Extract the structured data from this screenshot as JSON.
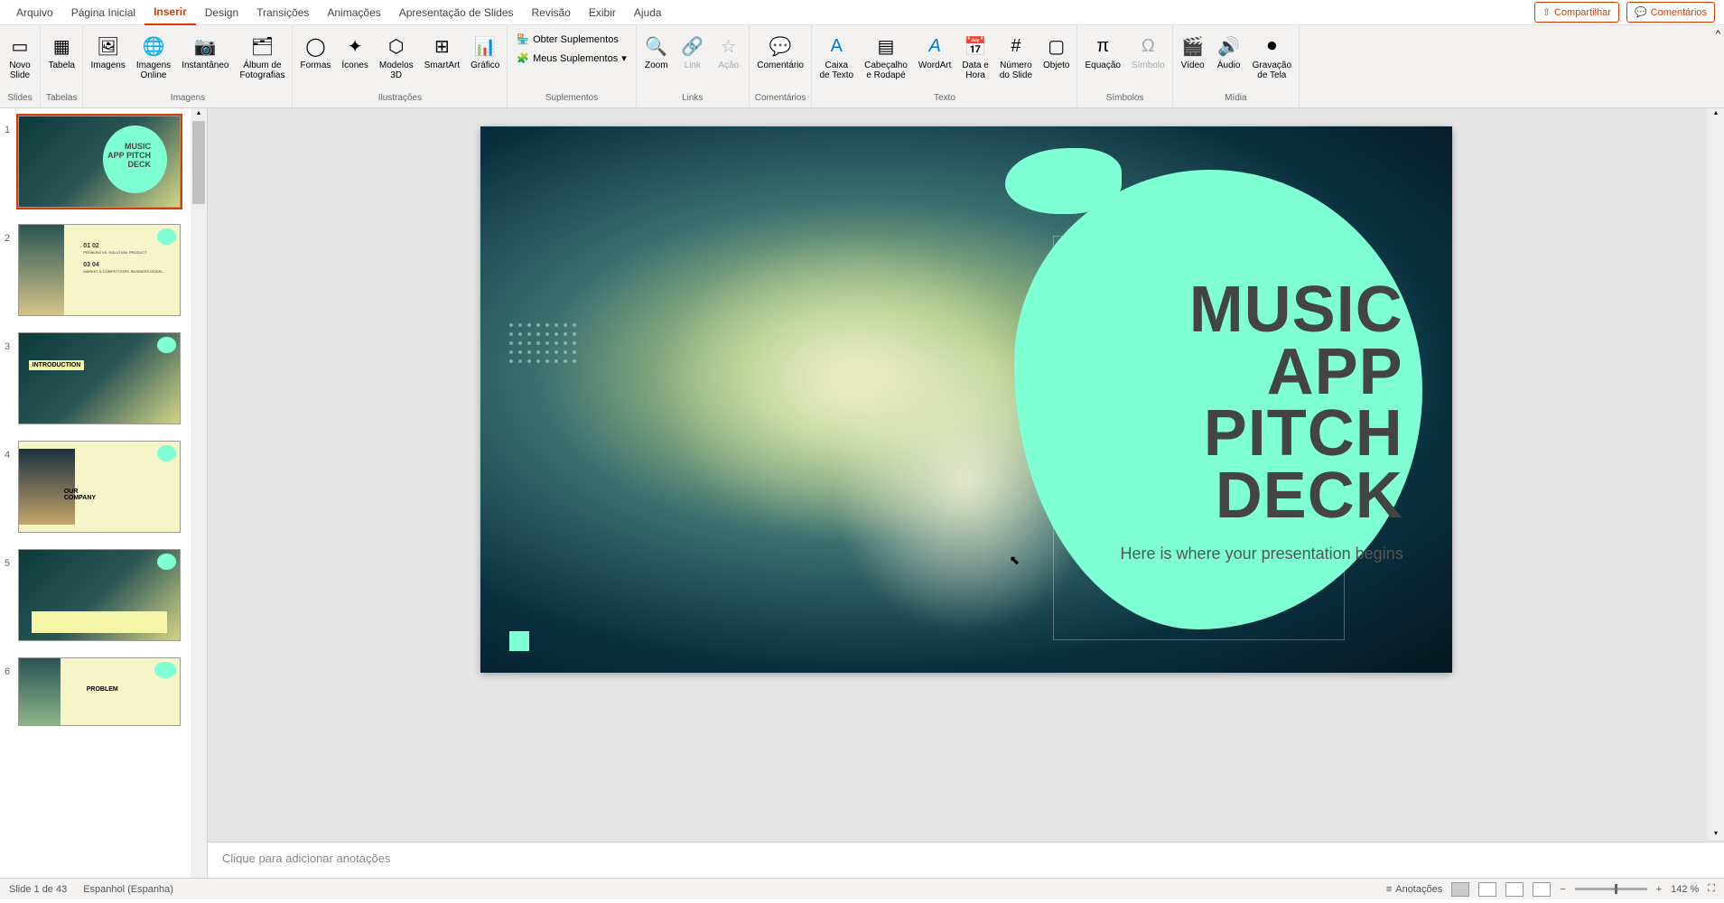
{
  "tabs": {
    "arquivo": "Arquivo",
    "pagina_inicial": "Página Inicial",
    "inserir": "Inserir",
    "design": "Design",
    "transicoes": "Transições",
    "animacoes": "Animações",
    "apresentacao": "Apresentação de Slides",
    "revisao": "Revisão",
    "exibir": "Exibir",
    "ajuda": "Ajuda"
  },
  "top_right": {
    "compartilhar": "Compartilhar",
    "comentarios": "Comentários"
  },
  "ribbon": {
    "novo_slide": "Novo\nSlide",
    "tabela": "Tabela",
    "imagens": "Imagens",
    "imagens_online": "Imagens\nOnline",
    "instantaneo": "Instantâneo",
    "album_fotografias": "Álbum de\nFotografias",
    "formas": "Formas",
    "icones": "Ícones",
    "modelos_3d": "Modelos\n3D",
    "smartart": "SmartArt",
    "grafico": "Gráfico",
    "obter_suplementos": "Obter Suplementos",
    "meus_suplementos": "Meus Suplementos",
    "zoom": "Zoom",
    "link": "Link",
    "acao": "Ação",
    "comentario": "Comentário",
    "caixa_texto": "Caixa\nde Texto",
    "cabecalho_rodape": "Cabeçalho\ne Rodapé",
    "wordart": "WordArt",
    "data_hora": "Data e\nHora",
    "numero_slide": "Número\ndo Slide",
    "objeto": "Objeto",
    "equacao": "Equação",
    "simbolo": "Símbolo",
    "video": "Vídeo",
    "audio": "Áudio",
    "gravacao_tela": "Gravação\nde Tela",
    "groups": {
      "slides": "Slides",
      "tabelas": "Tabelas",
      "imagens_g": "Imagens",
      "ilustracoes": "Ilustrações",
      "suplementos": "Suplementos",
      "links": "Links",
      "comentarios_g": "Comentários",
      "texto": "Texto",
      "simbolos": "Símbolos",
      "midia": "Mídia"
    }
  },
  "slide": {
    "title_line1": "MUSIC",
    "title_line2": "APP PITCH",
    "title_line3": "DECK",
    "subtitle": "Here is where your presentation begins"
  },
  "thumbnails": {
    "s2_01": "01",
    "s2_02": "02",
    "s2_03": "03",
    "s2_04": "04",
    "s2_t1": "PROBLEM VS. SOLUTION",
    "s2_t2": "PRODUCT",
    "s2_t3": "MARKET & COMPETITORS",
    "s2_t4": "BUSINESS MODEL",
    "s3_title": "INTRODUCTION",
    "s4_title": "OUR\nCOMPANY",
    "s6_title": "PROBLEM"
  },
  "notes": {
    "placeholder": "Clique para adicionar anotações"
  },
  "status": {
    "slide_count": "Slide 1 de 43",
    "language": "Espanhol (Espanha)",
    "anotacoes": "Anotações",
    "zoom": "142 %"
  }
}
